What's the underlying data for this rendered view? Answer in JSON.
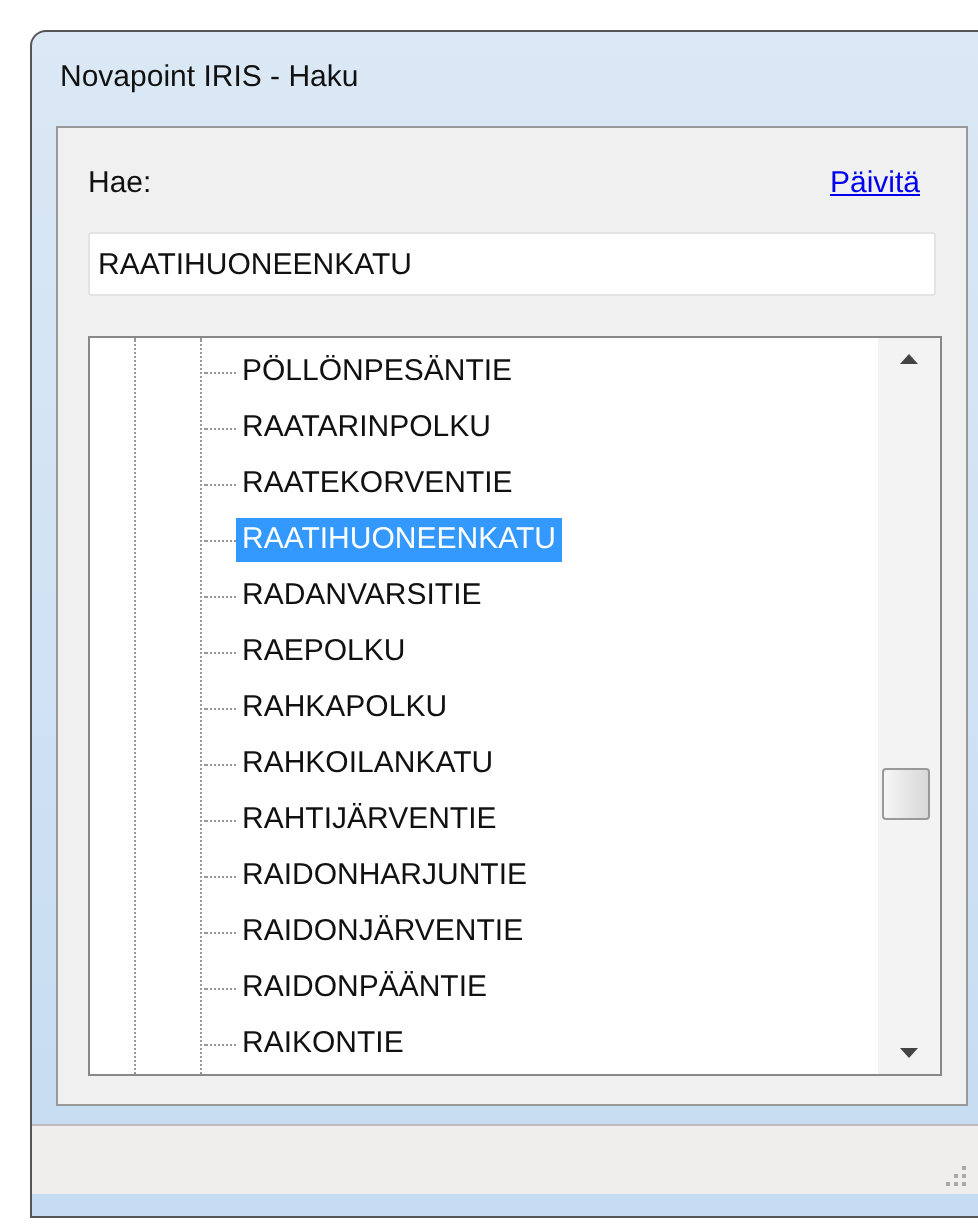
{
  "window": {
    "title": "Novapoint IRIS - Haku"
  },
  "search": {
    "label": "Hae:",
    "refresh_link": "Päivitä",
    "value": "RAATIHUONEENKATU"
  },
  "tree": {
    "items": [
      {
        "label": "PÖLLÖNPESÄNTIE",
        "selected": false
      },
      {
        "label": "RAATARINPOLKU",
        "selected": false
      },
      {
        "label": "RAATEKORVENTIE",
        "selected": false
      },
      {
        "label": "RAATIHUONEENKATU",
        "selected": true
      },
      {
        "label": "RADANVARSITIE",
        "selected": false
      },
      {
        "label": "RAEPOLKU",
        "selected": false
      },
      {
        "label": "RAHKAPOLKU",
        "selected": false
      },
      {
        "label": "RAHKOILANKATU",
        "selected": false
      },
      {
        "label": "RAHTIJÄRVENTIE",
        "selected": false
      },
      {
        "label": "RAIDONHARJUNTIE",
        "selected": false
      },
      {
        "label": "RAIDONJÄRVENTIE",
        "selected": false
      },
      {
        "label": "RAIDONPÄÄNTIE",
        "selected": false
      },
      {
        "label": "RAIKONTIE",
        "selected": false
      }
    ]
  }
}
